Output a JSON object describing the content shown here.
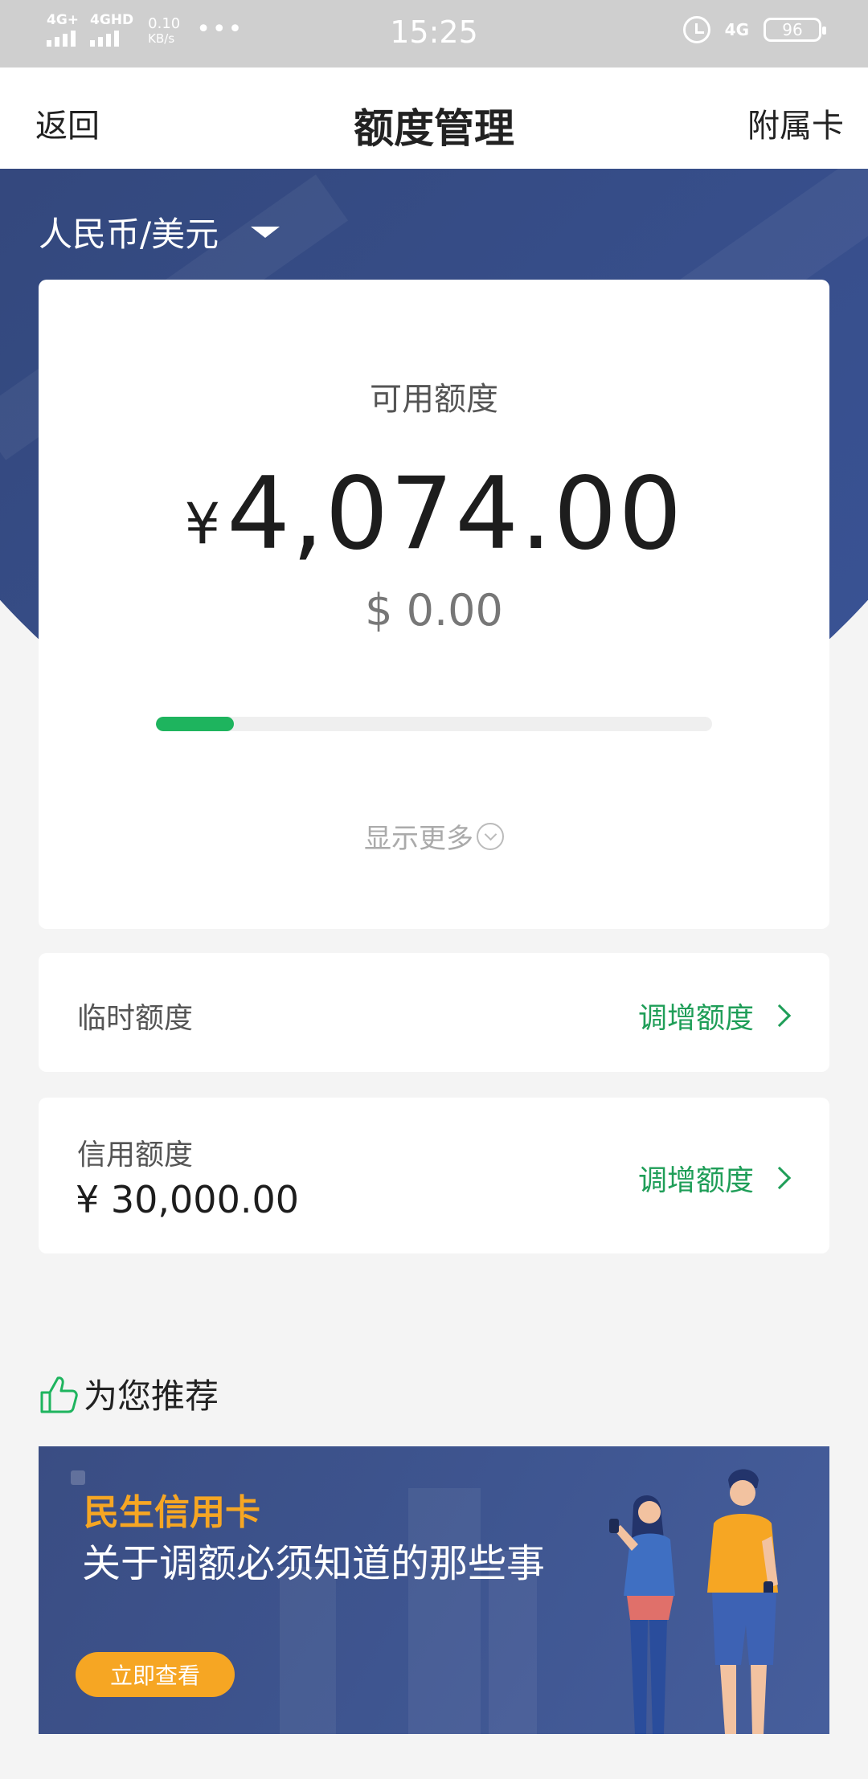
{
  "status_bar": {
    "sim1": "4G+",
    "sim2": "4GHD",
    "speed_value": "0.10",
    "speed_unit": "KB/s",
    "more_dots": "•••",
    "time": "15:25",
    "network": "4G",
    "battery": "96"
  },
  "nav": {
    "back_label": "返回",
    "title": "额度管理",
    "right_label": "附属卡"
  },
  "currency_selector": {
    "label": "人民币/美元"
  },
  "available": {
    "label": "可用额度",
    "rmb_symbol": "¥",
    "rmb_amount": "4,074.00",
    "usd_amount": "$ 0.00",
    "progress_percent": 14,
    "show_more_label": "显示更多"
  },
  "temporary_limit": {
    "label": "临时额度",
    "action_label": "调增额度"
  },
  "credit_limit": {
    "label": "信用额度",
    "value": "¥ 30,000.00",
    "action_label": "调增额度"
  },
  "recommend": {
    "title": "为您推荐",
    "banner": {
      "brand": "民生信用卡",
      "headline": "关于调额必须知道的那些事",
      "button_label": "立即查看"
    }
  },
  "colors": {
    "accent_green": "#1eb45e",
    "action_green": "#1f9e58",
    "header_blue": "#34497f",
    "banner_orange": "#f6a623"
  }
}
